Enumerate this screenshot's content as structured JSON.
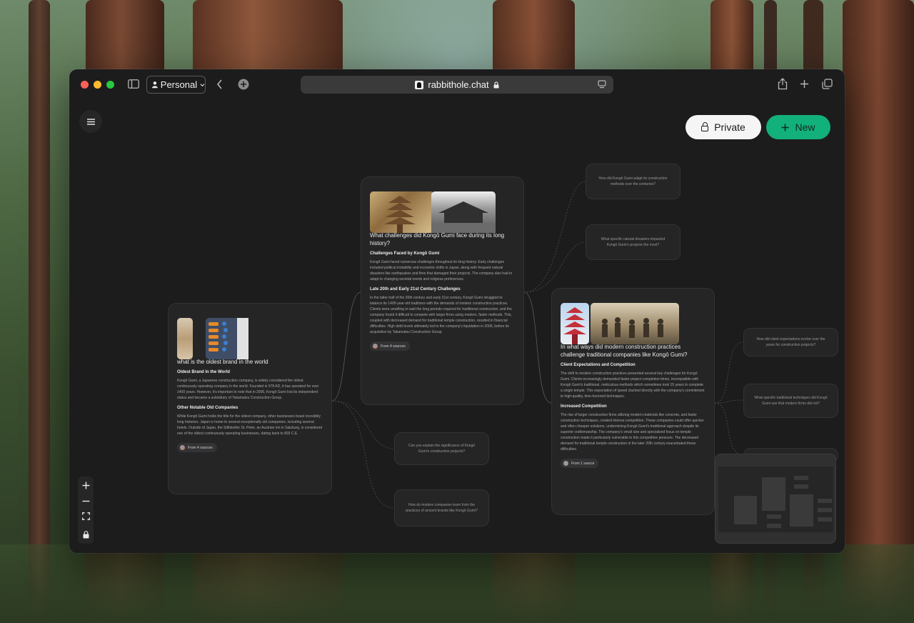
{
  "browser": {
    "profile_label": "Personal",
    "url": "rabbithole.chat"
  },
  "header": {
    "private_label": "Private",
    "new_label": "New"
  },
  "cards": {
    "oldest": {
      "title": "what is the oldest brand in the world",
      "section1": "Oldest Brand in the World",
      "p1": "Kongō Gumi, a Japanese construction company, is widely considered the oldest continuously operating company in the world. Founded in 578 AD, it has operated for over 1400 years. However, it's important to note that in 2006, Kongō Gumi lost its independent status and became a subsidiary of Takamatsu Construction Group.",
      "section2": "Other Notable Old Companies",
      "p2": "While Kongō Gumi holds the title for the oldest company, other businesses boast incredibly long histories. Japan is home to several exceptionally old companies, including several hotels. Outside of Japan, the Stiftskeller St. Peter, an Austrian inn in Salzburg, is considered one of the oldest continuously operating businesses, dating back to 803 C.E.",
      "sources": "From 4 sources"
    },
    "challenges": {
      "title": "What challenges did Kongō Gumi face during its long history?",
      "section1": "Challenges Faced by Kongō Gumi",
      "p1": "Kongō Gumi faced numerous challenges throughout its long history. Early challenges included political instability and economic shifts in Japan, along with frequent natural disasters like earthquakes and fires that damaged their projects. The company also had to adapt to changing societal needs and religious preferences.",
      "section2": "Late 20th and Early 21st Century Challenges",
      "p2": "In the latter half of the 20th century and early 21st century, Kongō Gumi struggled to balance its 1400-year-old traditions with the demands of modern construction practices. Clients were unwilling to wait the long periods required for traditional construction, and the company found it difficult to compete with larger firms using modern, faster methods. This, coupled with decreased demand for traditional temple construction, resulted in financial difficulties. High debt levels ultimately led to the company's liquidation in 2006, before its acquisition by Takamatsu Construction Group",
      "sources": "From 4 sources"
    },
    "modern": {
      "title": "In what ways did modern construction practices challenge traditional companies like Kongō Gumi?",
      "section1": "Client Expectations and Competition",
      "p1": "The shift to modern construction practices presented several key challenges for Kongō Gumi. Clients increasingly demanded faster project completion times, incompatible with Kongō Gumi's traditional, meticulous methods which sometimes took 15 years to complete a single temple. This expectation of speed clashed directly with the company's commitment to high-quality, time-honored techniques.",
      "section2": "Increased Competition",
      "p2": "The rise of larger construction firms utilizing modern materials like concrete, and faster construction techniques, created intense competition. These companies could offer quicker and often cheaper solutions, undermining Kongō Gumi's traditional approach despite its superior craftsmanship. The company's small size and specialized focus on temple construction made it particularly vulnerable to this competitive pressure. The decreased demand for traditional temple construction in the later 20th century exacerbated these difficulties.",
      "sources": "From 1 source"
    }
  },
  "questions": {
    "q1": "How did Kongō Gumi adapt its construction methods over the centuries?",
    "q2": "What specific natural disasters impacted Kongō Gumi's projects the most?",
    "q3": "Can you explain the significance of Kongō Gumi's construction projects?",
    "q4": "How do modern companies learn from the practices of ancient brands like Kongō Gumi?",
    "q5": "How did client expectations evolve over the years for construction projects?",
    "q6": "What specific traditional techniques did Kongō Gumi use that modern firms did not?"
  },
  "icons": [
    "sidebar-icon",
    "person-icon",
    "chevron-down-icon",
    "back-icon",
    "extensions-icon",
    "lock-icon",
    "reader-icon",
    "share-icon",
    "plus-icon",
    "tabs-icon",
    "menu-icon",
    "zoom-in-icon",
    "zoom-out-icon",
    "fit-view-icon",
    "lock-canvas-icon"
  ],
  "colors": {
    "accent_new": "#12b07a",
    "card_bg": "#252526",
    "canvas_bg": "#1c1c1d"
  }
}
